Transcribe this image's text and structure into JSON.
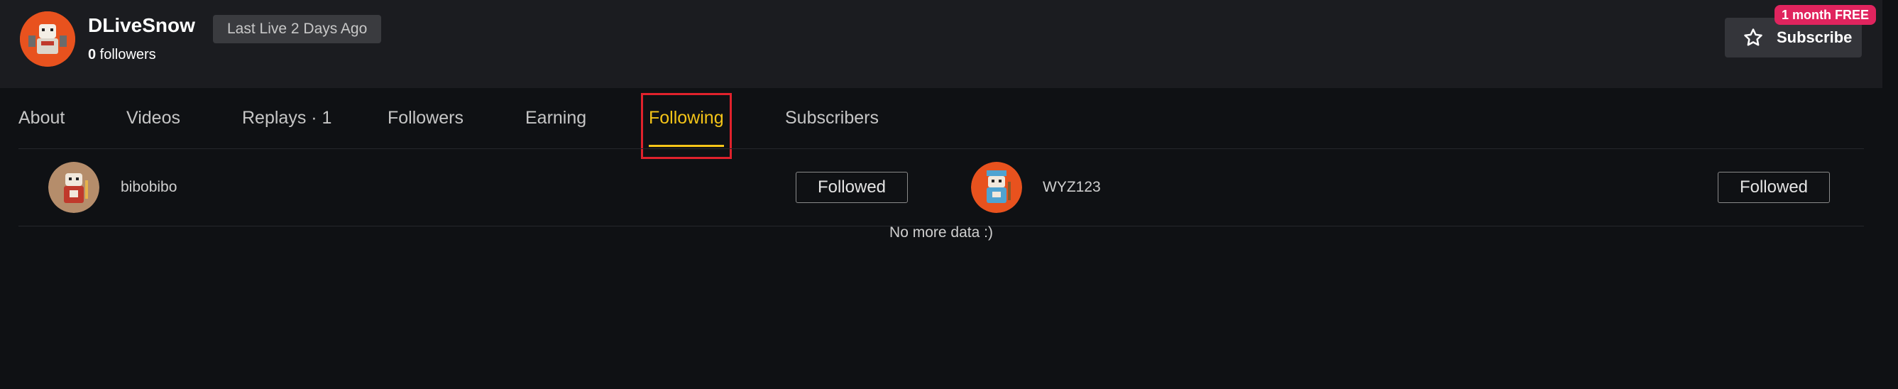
{
  "channel": {
    "name": "DLiveSnow",
    "followers_count": "0",
    "followers_label": " followers",
    "last_live": "Last Live 2 Days Ago"
  },
  "subscribe": {
    "label": "Subscribe",
    "promo": "1 month FREE"
  },
  "tabs": [
    {
      "label": "About"
    },
    {
      "label": "Videos"
    },
    {
      "label": "Replays · 1"
    },
    {
      "label": "Followers"
    },
    {
      "label": "Earning"
    },
    {
      "label": "Following",
      "active": true
    },
    {
      "label": "Subscribers"
    }
  ],
  "following": [
    {
      "username": "bibobibo",
      "button": "Followed"
    },
    {
      "username": "WYZ123",
      "button": "Followed"
    }
  ],
  "footer_text": "No more data :)",
  "colors": {
    "accent": "#f5c518",
    "highlight": "#e0222c",
    "promo": "#e0245e",
    "avatar_orange": "#e8521e"
  }
}
